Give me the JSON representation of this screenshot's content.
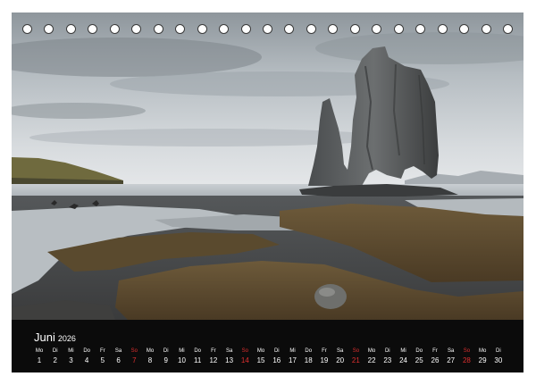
{
  "calendar": {
    "month": "Juni",
    "year": "2026",
    "days": [
      {
        "wd": "Mo",
        "d": "1",
        "sun": false
      },
      {
        "wd": "Di",
        "d": "2",
        "sun": false
      },
      {
        "wd": "Mi",
        "d": "3",
        "sun": false
      },
      {
        "wd": "Do",
        "d": "4",
        "sun": false
      },
      {
        "wd": "Fr",
        "d": "5",
        "sun": false
      },
      {
        "wd": "Sa",
        "d": "6",
        "sun": false
      },
      {
        "wd": "So",
        "d": "7",
        "sun": true
      },
      {
        "wd": "Mo",
        "d": "8",
        "sun": false
      },
      {
        "wd": "Di",
        "d": "9",
        "sun": false
      },
      {
        "wd": "Mi",
        "d": "10",
        "sun": false
      },
      {
        "wd": "Do",
        "d": "11",
        "sun": false
      },
      {
        "wd": "Fr",
        "d": "12",
        "sun": false
      },
      {
        "wd": "Sa",
        "d": "13",
        "sun": false
      },
      {
        "wd": "So",
        "d": "14",
        "sun": true
      },
      {
        "wd": "Mo",
        "d": "15",
        "sun": false
      },
      {
        "wd": "Di",
        "d": "16",
        "sun": false
      },
      {
        "wd": "Mi",
        "d": "17",
        "sun": false
      },
      {
        "wd": "Do",
        "d": "18",
        "sun": false
      },
      {
        "wd": "Fr",
        "d": "19",
        "sun": false
      },
      {
        "wd": "Sa",
        "d": "20",
        "sun": false
      },
      {
        "wd": "So",
        "d": "21",
        "sun": true
      },
      {
        "wd": "Mo",
        "d": "22",
        "sun": false
      },
      {
        "wd": "Di",
        "d": "23",
        "sun": false
      },
      {
        "wd": "Mi",
        "d": "24",
        "sun": false
      },
      {
        "wd": "Do",
        "d": "25",
        "sun": false
      },
      {
        "wd": "Fr",
        "d": "26",
        "sun": false
      },
      {
        "wd": "Sa",
        "d": "27",
        "sun": false
      },
      {
        "wd": "So",
        "d": "28",
        "sun": true
      },
      {
        "wd": "Mo",
        "d": "29",
        "sun": false
      },
      {
        "wd": "Di",
        "d": "30",
        "sun": false
      }
    ]
  },
  "colors": {
    "calendar_background": "#0b0b0b",
    "sunday_highlight": "#e03030",
    "text": "#ffffff"
  }
}
